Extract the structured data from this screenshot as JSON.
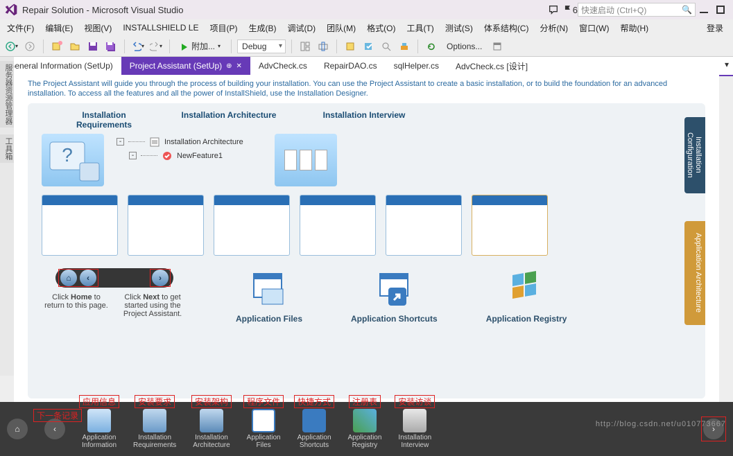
{
  "window_title": "Repair Solution - Microsoft Visual Studio",
  "flag_count": "6",
  "quick_launch_placeholder": "快速启动 (Ctrl+Q)",
  "menu": {
    "file": "文件(F)",
    "edit": "编辑(E)",
    "view": "视图(V)",
    "installshield": "INSTALLSHIELD LE",
    "project": "项目(P)",
    "build": "生成(B)",
    "debug": "调试(D)",
    "team": "团队(M)",
    "format": "格式(O)",
    "tools": "工具(T)",
    "test": "测试(S)",
    "arch": "体系结构(C)",
    "analyze": "分析(N)",
    "window": "窗口(W)",
    "help": "帮助(H)",
    "login": "登录"
  },
  "toolbar": {
    "attach": "附加...",
    "config": "Debug",
    "options": "Options..."
  },
  "tabs": [
    {
      "label": "General Information (SetUp)",
      "active": false
    },
    {
      "label": "Project Assistant (SetUp)",
      "active": true
    },
    {
      "label": "AdvCheck.cs",
      "active": false
    },
    {
      "label": "RepairDAO.cs",
      "active": false
    },
    {
      "label": "sqlHelper.cs",
      "active": false
    },
    {
      "label": "AdvCheck.cs [设计]",
      "active": false
    }
  ],
  "side_left": [
    "服务器资源管理器",
    "工具箱"
  ],
  "intro": "The Project Assistant will guide you through the process of building your installation. You can use the Project Assistant to create a basic installation, or to build the foundation for an advanced installation. To access all the features and all the power of InstallShield, use the Installation Designer.",
  "panel": {
    "headers": [
      "Installation Requirements",
      "Installation Architecture",
      "Installation Interview"
    ],
    "tree": {
      "root": "Installation Architecture",
      "child": "NewFeature1"
    },
    "sidetabs": [
      "Installation Configuration",
      "Application Architecture"
    ],
    "apps": [
      "Application Files",
      "Application Shortcuts",
      "Application Registry"
    ],
    "nav_home_hint": "Click Home to return to this page.",
    "nav_next_hint": "Click Next to get started using the Project Assistant.",
    "nav_home_b": "Home",
    "nav_next_b": "Next"
  },
  "bottom_labels_zh": [
    "应用信息",
    "安装要求",
    "安装架构",
    "程序文件",
    "快捷方式",
    "注册表",
    "安装访谈"
  ],
  "bottom_labels_zh_nav": "下一条记录",
  "bottom_items": [
    {
      "l1": "Application",
      "l2": "Information"
    },
    {
      "l1": "Installation",
      "l2": "Requirements"
    },
    {
      "l1": "Installation",
      "l2": "Architecture"
    },
    {
      "l1": "Application",
      "l2": "Files"
    },
    {
      "l1": "Application",
      "l2": "Shortcuts"
    },
    {
      "l1": "Application",
      "l2": "Registry"
    },
    {
      "l1": "Installation",
      "l2": "Interview"
    }
  ],
  "watermark": "http://blog.csdn.net/u010773667"
}
